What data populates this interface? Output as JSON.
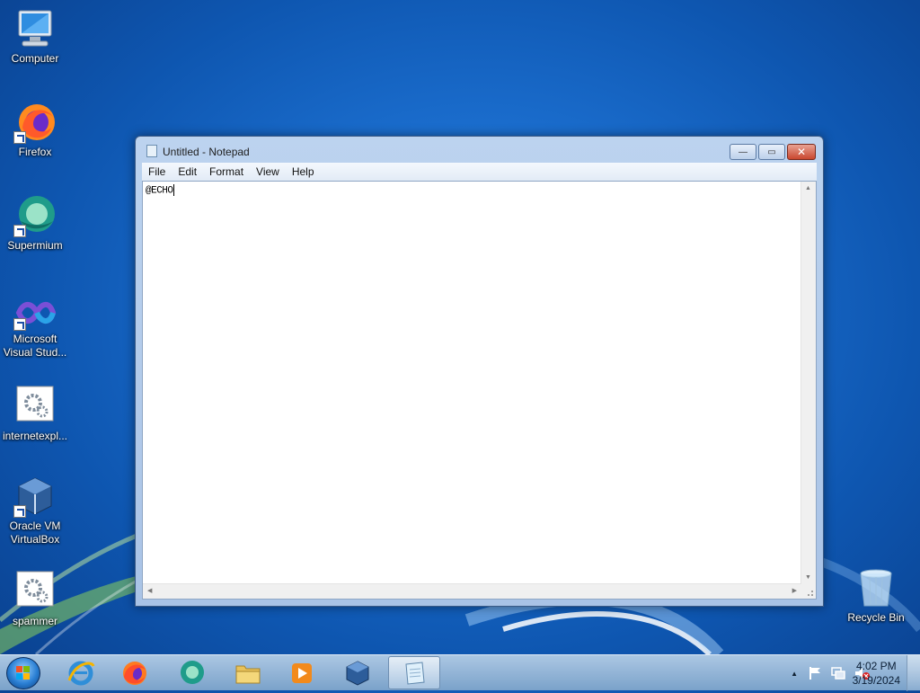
{
  "desktop_icons": [
    {
      "label": "Computer",
      "icon": "computer-icon"
    },
    {
      "label": "Firefox",
      "icon": "firefox-icon"
    },
    {
      "label": "Supermium",
      "icon": "supermium-icon"
    },
    {
      "label": "Microsoft Visual Stud...",
      "icon": "visual-studio-icon"
    },
    {
      "label": "internetexpl...",
      "icon": "settings-file-icon"
    },
    {
      "label": "Oracle VM VirtualBox",
      "icon": "virtualbox-icon"
    },
    {
      "label": "spammer",
      "icon": "settings-file-icon"
    },
    {
      "label": "Recycle Bin",
      "icon": "recycle-bin-icon"
    }
  ],
  "notepad": {
    "title": "Untitled - Notepad",
    "menu": [
      "File",
      "Edit",
      "Format",
      "View",
      "Help"
    ],
    "content": "@ECHO",
    "buttons": {
      "minimize": "—",
      "maximize": "▭",
      "close": "✕"
    }
  },
  "taskbar": {
    "items": [
      "start-orb",
      "internet-explorer",
      "firefox",
      "supermium",
      "file-explorer",
      "media-player",
      "virtualbox",
      "notepad"
    ],
    "active": "notepad",
    "tray": {
      "show_hidden": "▲"
    },
    "clock": {
      "time": "4:02 PM",
      "date": "3/19/2024"
    }
  },
  "colors": {
    "desktop": "#1a6ccc",
    "taskbar": "#7da4cc",
    "close_button": "#c9472f"
  }
}
